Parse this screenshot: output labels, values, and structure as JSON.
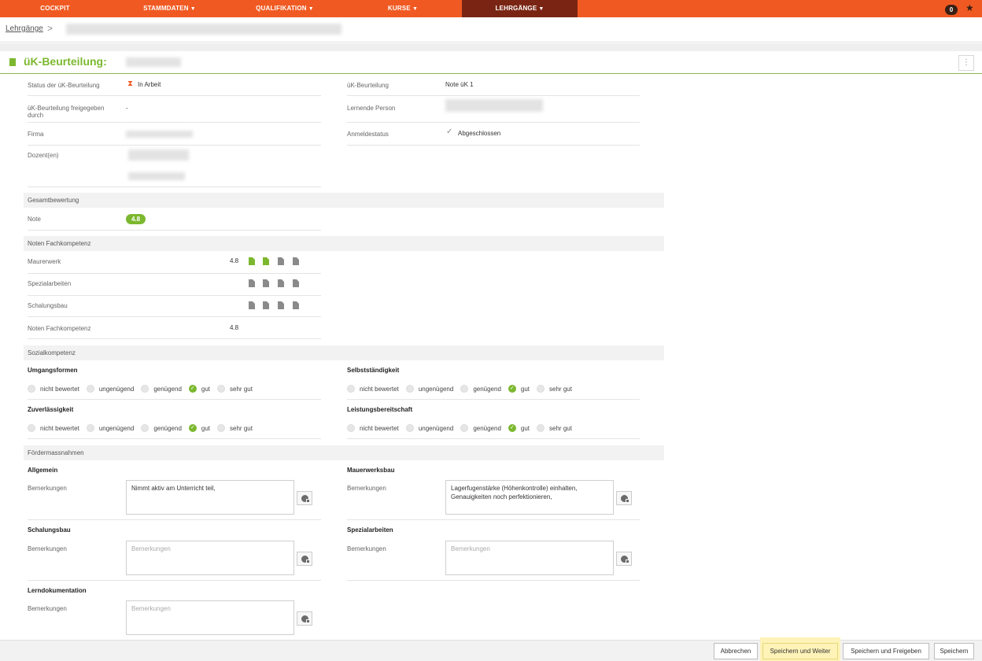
{
  "nav": {
    "items": [
      "COCKPIT",
      "STAMMDATEN",
      "QUALIFIKATION",
      "KURSE",
      "LEHRGÄNGE"
    ],
    "notification_count": "0",
    "accent": "#f05a22",
    "active_bg": "#7a2514"
  },
  "breadcrumb": {
    "root": "Lehrgänge",
    "separator": ">"
  },
  "page": {
    "title": "üK-Beurteilung:"
  },
  "info": {
    "status_label": "Status der üK-Beurteilung",
    "status_value": "In Arbeit",
    "released_label": "üK-Beurteilung freigegeben durch",
    "released_value": "-",
    "firma_label": "Firma",
    "dozent_label": "Dozent(en)",
    "beurteilung_label": "üK-Beurteilung",
    "beurteilung_value": "Note üK 1",
    "lernende_label": "Lernende Person",
    "anmelde_label": "Anmeldestatus",
    "anmelde_value": "Abgeschlossen"
  },
  "gesamt": {
    "header": "Gesamtbewertung",
    "note_label": "Note",
    "note_value": "4.8"
  },
  "fach": {
    "header": "Noten Fachkompetenz",
    "rows": [
      {
        "label": "Maurerwerk",
        "value": "4.8"
      },
      {
        "label": "Spezialarbeiten",
        "value": ""
      },
      {
        "label": "Schalungsbau",
        "value": ""
      },
      {
        "label": "Noten Fachkompetenz",
        "value": "4.8"
      }
    ]
  },
  "sozial": {
    "header": "Sozialkompetenz",
    "options": [
      "nicht bewertet",
      "ungenügend",
      "genügend",
      "gut",
      "sehr gut"
    ],
    "groups": [
      {
        "title": "Umgangsformen",
        "selected": "gut"
      },
      {
        "title": "Selbstständigkeit",
        "selected": "gut"
      },
      {
        "title": "Zuverlässigkeit",
        "selected": "gut"
      },
      {
        "title": "Leistungsbereitschaft",
        "selected": "gut"
      }
    ]
  },
  "foerder": {
    "header": "Fördermassnahmen",
    "remark_label": "Bemerkungen",
    "placeholder": "Bemerkungen",
    "blocks": [
      {
        "title": "Allgemein",
        "text": "Nimmt aktiv am Unterricht teil,"
      },
      {
        "title": "Mauerwerksbau",
        "text": "Lagerfugenstärke (Höhenkontrolle) einhalten,\nGenauigkeiten noch perfektionieren,"
      },
      {
        "title": "Schalungsbau",
        "text": ""
      },
      {
        "title": "Spezialarbeiten",
        "text": ""
      },
      {
        "title": "Lerndokumentation",
        "text": ""
      }
    ]
  },
  "footer": {
    "cancel": "Abbrechen",
    "save_next": "Speichern und Weiter",
    "save_release": "Speichern und Freigeben",
    "save": "Speichern"
  }
}
